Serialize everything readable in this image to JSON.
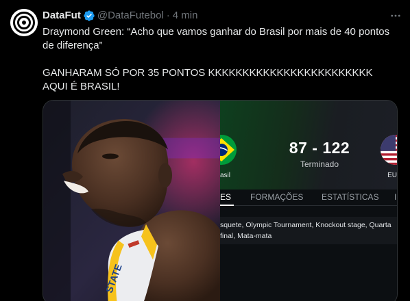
{
  "tweet": {
    "author_name": "DataFut",
    "handle": "@DataFutebol",
    "separator": "·",
    "time": "4 min",
    "text_line1": "Draymond Green: “Acho que vamos ganhar do Brasil por mais de 40 pontos",
    "text_line2": "de diferença”",
    "text_line3": "GANHARAM SÓ POR 35 PONTOS KKKKKKKKKKKKKKKKKKKKKKKK",
    "text_line4": "AQUI É BRASIL!"
  },
  "match_card": {
    "score": "87 - 122",
    "status": "Terminado",
    "home_team_label": "asil",
    "away_team_label": "EU",
    "tabs": [
      "ES",
      "FORMAÇÕES",
      "ESTATÍSTICAS",
      "I"
    ],
    "info_line1": "squete, Olympic Tournament, Knockout stage, Quarta",
    "info_line2": "final, Mata-mata"
  },
  "colors": {
    "background": "#000000",
    "text_primary": "#e7e9ea",
    "text_secondary": "#71767b",
    "verified_blue": "#1d9bf0",
    "brazil_green": "#0e3f1e"
  },
  "icons": {
    "verified": "verified-badge-icon",
    "more": "more-options-icon",
    "avatar": "datafut-logo-icon"
  }
}
